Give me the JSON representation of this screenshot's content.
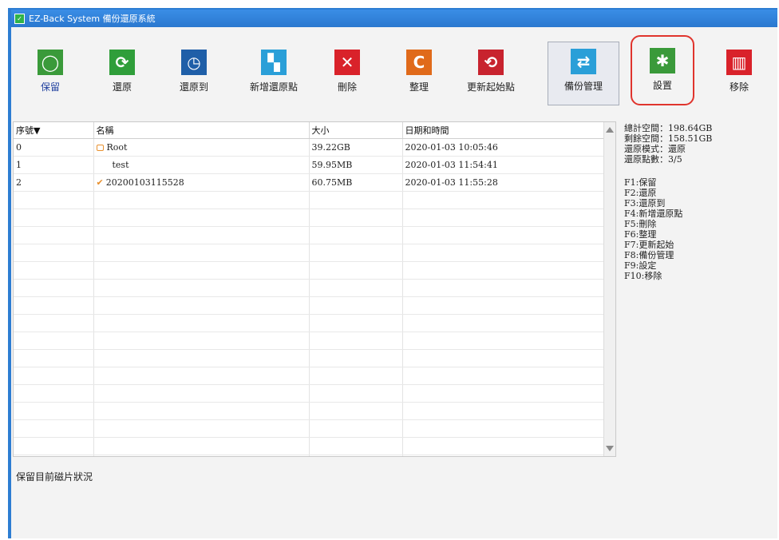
{
  "window": {
    "title": "EZ-Back System 備份還原系統"
  },
  "toolbar": {
    "buttons": [
      {
        "label": "保留",
        "icon": "keep-icon",
        "color": "#3a9a3a"
      },
      {
        "label": "還原",
        "icon": "restore-icon",
        "color": "#2f9e3a"
      },
      {
        "label": "還原到",
        "icon": "restore-to-icon",
        "color": "#1f5fa8"
      },
      {
        "label": "新增還原點",
        "icon": "add-restore-point-icon",
        "color": "#2a9fd8"
      },
      {
        "label": "刪除",
        "icon": "delete-icon",
        "color": "#d9222a"
      },
      {
        "label": "整理",
        "icon": "organize-icon",
        "color": "#e06a1a"
      },
      {
        "label": "更新起始點",
        "icon": "update-start-icon",
        "color": "#c8232e"
      },
      {
        "label": "備份管理",
        "icon": "backup-manage-icon",
        "color": "#2a9fd8"
      },
      {
        "label": "設置",
        "icon": "settings-icon",
        "color": "#3a9a3a"
      },
      {
        "label": "移除",
        "icon": "remove-icon",
        "color": "#d9222a"
      }
    ]
  },
  "table": {
    "columns": [
      "序號▼",
      "名稱",
      "大小",
      "日期和時間"
    ],
    "rows": [
      {
        "index": "0",
        "name": "Root",
        "size": "39.22GB",
        "datetime": "2020-01-03 10:05:46",
        "marker": "lock"
      },
      {
        "index": "1",
        "name": "test",
        "size": "59.95MB",
        "datetime": "2020-01-03 11:54:41",
        "marker": ""
      },
      {
        "index": "2",
        "name": "20200103115528",
        "size": "60.75MB",
        "datetime": "2020-01-03 11:55:28",
        "marker": "check"
      }
    ]
  },
  "info": {
    "total": "總計空間：198.64GB",
    "free": "剩餘空間：158.51GB",
    "mode": "還原模式：還原",
    "points": "還原點數：3/5",
    "shortcuts": [
      "F1:保留",
      "F2:還原",
      "F3:還原到",
      "F4:新增還原點",
      "F5:刪除",
      "F6:整理",
      "F7:更新起始",
      "F8:備份管理",
      "F9:設定",
      "F10:移除"
    ]
  },
  "status": {
    "text": "保留目前磁片狀況"
  }
}
